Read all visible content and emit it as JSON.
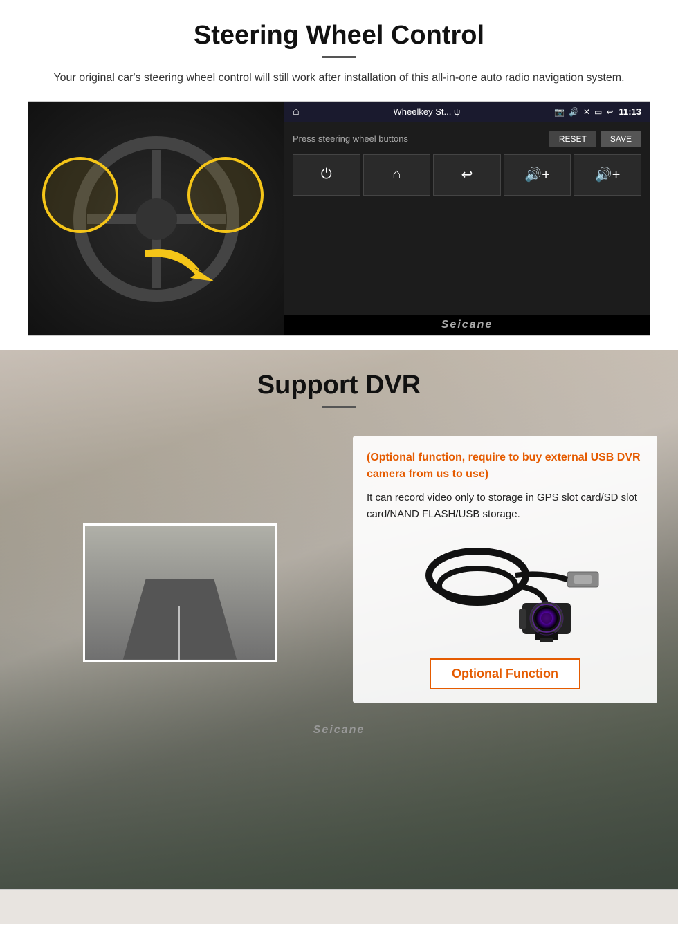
{
  "section1": {
    "title": "Steering Wheel Control",
    "subtitle": "Your original car's steering wheel control will still work after installation of this all-in-one auto radio navigation system.",
    "android_ui": {
      "status_bar": {
        "app_title": "Wheelkey St... ψ",
        "time": "11:13"
      },
      "swc": {
        "label": "Press steering wheel buttons",
        "reset_label": "RESET",
        "save_label": "SAVE"
      },
      "buttons": [
        "⏻",
        "⌂",
        "↩",
        "🔊+",
        "🔊+"
      ]
    },
    "seicane_watermark": "Seicane"
  },
  "section2": {
    "title": "Support DVR",
    "info_box": {
      "optional_text": "(Optional function, require to buy external USB DVR camera from us to use)",
      "description": "It can record video only to storage in GPS slot card/SD slot card/NAND FLASH/USB storage.",
      "optional_function_label": "Optional Function"
    },
    "seicane_watermark": "Seicane"
  }
}
